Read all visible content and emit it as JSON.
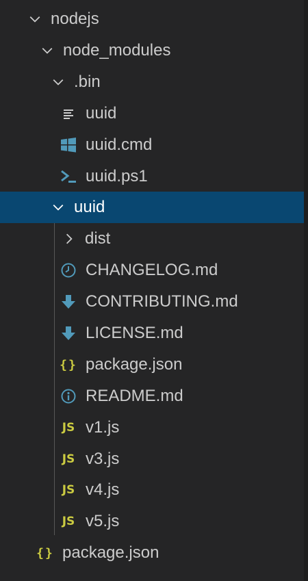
{
  "tree": {
    "nodejs": {
      "label": "nodejs",
      "expanded": true
    },
    "node_modules": {
      "label": "node_modules",
      "expanded": true
    },
    "bin": {
      "label": ".bin",
      "expanded": true
    },
    "bin_files": [
      {
        "label": "uuid",
        "icon": "text-file-icon"
      },
      {
        "label": "uuid.cmd",
        "icon": "windows-icon"
      },
      {
        "label": "uuid.ps1",
        "icon": "powershell-icon"
      }
    ],
    "uuid_folder": {
      "label": "uuid",
      "expanded": true,
      "selected": true
    },
    "dist": {
      "label": "dist",
      "expanded": false
    },
    "uuid_files": [
      {
        "label": "CHANGELOG.md",
        "icon": "clock-icon"
      },
      {
        "label": "CONTRIBUTING.md",
        "icon": "download-arrow-icon"
      },
      {
        "label": "LICENSE.md",
        "icon": "download-arrow-icon"
      },
      {
        "label": "package.json",
        "icon": "json-braces-icon"
      },
      {
        "label": "README.md",
        "icon": "info-icon"
      },
      {
        "label": "v1.js",
        "icon": "js-icon"
      },
      {
        "label": "v3.js",
        "icon": "js-icon"
      },
      {
        "label": "v4.js",
        "icon": "js-icon"
      },
      {
        "label": "v5.js",
        "icon": "js-icon"
      }
    ],
    "root_package": {
      "label": "package.json",
      "icon": "json-braces-icon"
    }
  },
  "colors": {
    "background": "#252526",
    "selection": "#094771",
    "text": "#cccccc",
    "js": "#cbcb41",
    "icon_blue": "#519aba"
  }
}
